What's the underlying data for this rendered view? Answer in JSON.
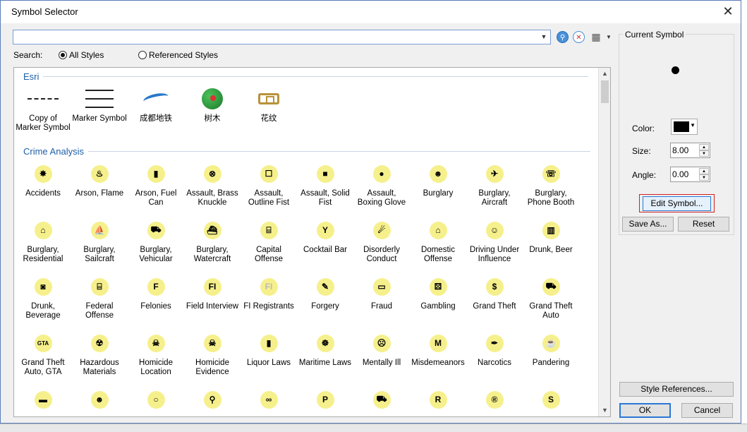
{
  "window": {
    "title": "Symbol Selector",
    "close_glyph": "✕"
  },
  "search": {
    "value": "",
    "label": "Search:",
    "options": [
      "All Styles",
      "Referenced Styles"
    ],
    "selected": "All Styles"
  },
  "toolbar_icons": [
    "search-icon",
    "clear-search-icon",
    "view-options-icon"
  ],
  "groups": [
    {
      "name": "Esri",
      "items": [
        {
          "label": "Copy of Marker Symbol",
          "icon": "dashed-line"
        },
        {
          "label": "Marker Symbol",
          "icon": "rail-lines"
        },
        {
          "label": "成都地铁",
          "icon": "blue-wave"
        },
        {
          "label": "树木",
          "icon": "tree"
        },
        {
          "label": "花纹",
          "icon": "ornament"
        }
      ]
    },
    {
      "name": "Crime Analysis",
      "items": [
        {
          "label": "Accidents",
          "glyph": "✸"
        },
        {
          "label": "Arson, Flame",
          "glyph": "♨"
        },
        {
          "label": "Arson, Fuel Can",
          "glyph": "▮"
        },
        {
          "label": "Assault, Brass Knuckle",
          "glyph": "⊗"
        },
        {
          "label": "Assault, Outline Fist",
          "glyph": "☐"
        },
        {
          "label": "Assault, Solid Fist",
          "glyph": "■"
        },
        {
          "label": "Assault, Boxing Glove",
          "glyph": "●"
        },
        {
          "label": "Burglary",
          "glyph": "☻"
        },
        {
          "label": "Burglary, Aircraft",
          "glyph": "✈"
        },
        {
          "label": "Burglary, Phone Booth",
          "glyph": "☏"
        },
        {
          "label": "Burglary, Residential",
          "glyph": "⌂"
        },
        {
          "label": "Burglary, Sailcraft",
          "glyph": "⛵"
        },
        {
          "label": "Burglary, Vehicular",
          "glyph": "⛟"
        },
        {
          "label": "Burglary, Watercraft",
          "glyph": "⛴"
        },
        {
          "label": "Capital Offense",
          "glyph": "⌸"
        },
        {
          "label": "Cocktail Bar",
          "glyph": "Y"
        },
        {
          "label": "Disorderly Conduct",
          "glyph": "☄"
        },
        {
          "label": "Domestic Offense",
          "glyph": "⌂"
        },
        {
          "label": "Driving Under Influence",
          "glyph": "☺"
        },
        {
          "label": "Drunk, Beer",
          "glyph": "▥"
        },
        {
          "label": "Drunk, Beverage",
          "glyph": "◙"
        },
        {
          "label": "Federal Offense",
          "glyph": "⌸"
        },
        {
          "label": "Felonies",
          "glyph": "F"
        },
        {
          "label": "Field Interview",
          "glyph": "FI"
        },
        {
          "label": "FI Registrants",
          "glyph": "FI"
        },
        {
          "label": "Forgery",
          "glyph": "✎"
        },
        {
          "label": "Fraud",
          "glyph": "▭"
        },
        {
          "label": "Gambling",
          "glyph": "⚄"
        },
        {
          "label": "Grand Theft",
          "glyph": "$"
        },
        {
          "label": "Grand Theft Auto",
          "glyph": "⛟"
        },
        {
          "label": "Grand Theft Auto, GTA",
          "glyph": "GTA"
        },
        {
          "label": "Hazardous Materials",
          "glyph": "☢"
        },
        {
          "label": "Homicide Location",
          "glyph": "☠"
        },
        {
          "label": "Homicide Evidence",
          "glyph": "☠"
        },
        {
          "label": "Liquor Laws",
          "glyph": "▮"
        },
        {
          "label": "Maritime Laws",
          "glyph": "☸"
        },
        {
          "label": "Mentally Ill",
          "glyph": "☹"
        },
        {
          "label": "Misdemeanors",
          "glyph": "M"
        },
        {
          "label": "Narcotics",
          "glyph": "✒"
        },
        {
          "label": "Pandering",
          "glyph": "☕"
        },
        {
          "label": "",
          "glyph": "▬"
        },
        {
          "label": "",
          "glyph": "☻"
        },
        {
          "label": "",
          "glyph": "○"
        },
        {
          "label": "",
          "glyph": "⚲"
        },
        {
          "label": "",
          "glyph": "∞"
        },
        {
          "label": "",
          "glyph": "P"
        },
        {
          "label": "",
          "glyph": "⛟"
        },
        {
          "label": "",
          "glyph": "R"
        },
        {
          "label": "",
          "glyph": "®"
        },
        {
          "label": "",
          "glyph": "S"
        }
      ]
    }
  ],
  "current_symbol": {
    "legend": "Current Symbol",
    "color_label": "Color:",
    "color": "#000000",
    "size_label": "Size:",
    "size": "8.00",
    "angle_label": "Angle:",
    "angle": "0.00"
  },
  "buttons": {
    "edit_symbol": "Edit Symbol...",
    "save_as": "Save As...",
    "reset": "Reset",
    "style_references": "Style References...",
    "ok": "OK",
    "cancel": "Cancel"
  },
  "colors": {
    "symbol_background": "#f6f08c",
    "group_header": "#1e5fa8",
    "highlight_border": "#d02020"
  }
}
